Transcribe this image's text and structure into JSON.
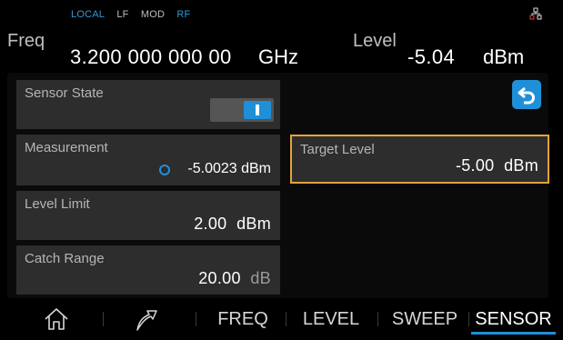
{
  "header": {
    "status": {
      "local": "LOCAL",
      "lf": "LF",
      "mod": "MOD",
      "rf": "RF"
    },
    "freq_label": "Freq",
    "freq_value": "3.200 000 000 00",
    "freq_unit": "GHz",
    "level_label": "Level",
    "level_value": "-5.04",
    "level_unit": "dBm",
    "network_icon": "network-icon"
  },
  "panel": {
    "sensor_state": {
      "title": "Sensor State",
      "toggle_on": true
    },
    "measurement": {
      "title": "Measurement",
      "value": "-5.0023 dBm"
    },
    "target_level": {
      "title": "Target Level",
      "value": "-5.00",
      "unit": "dBm"
    },
    "level_limit": {
      "title": "Level Limit",
      "value": "2.00",
      "unit": "dBm"
    },
    "catch_range": {
      "title": "Catch Range",
      "value": "20.00",
      "unit": "dB"
    },
    "back_icon": "back-arrow-icon"
  },
  "nav": {
    "home_icon": "home-icon",
    "shortcut_icon": "arrow-icon",
    "items": [
      "FREQ",
      "LEVEL",
      "SWEEP",
      "SENSOR"
    ],
    "active": "SENSOR"
  },
  "colors": {
    "accent": "#1f8fd8",
    "highlight": "#e6a23c",
    "tile": "#2d2d2d"
  }
}
